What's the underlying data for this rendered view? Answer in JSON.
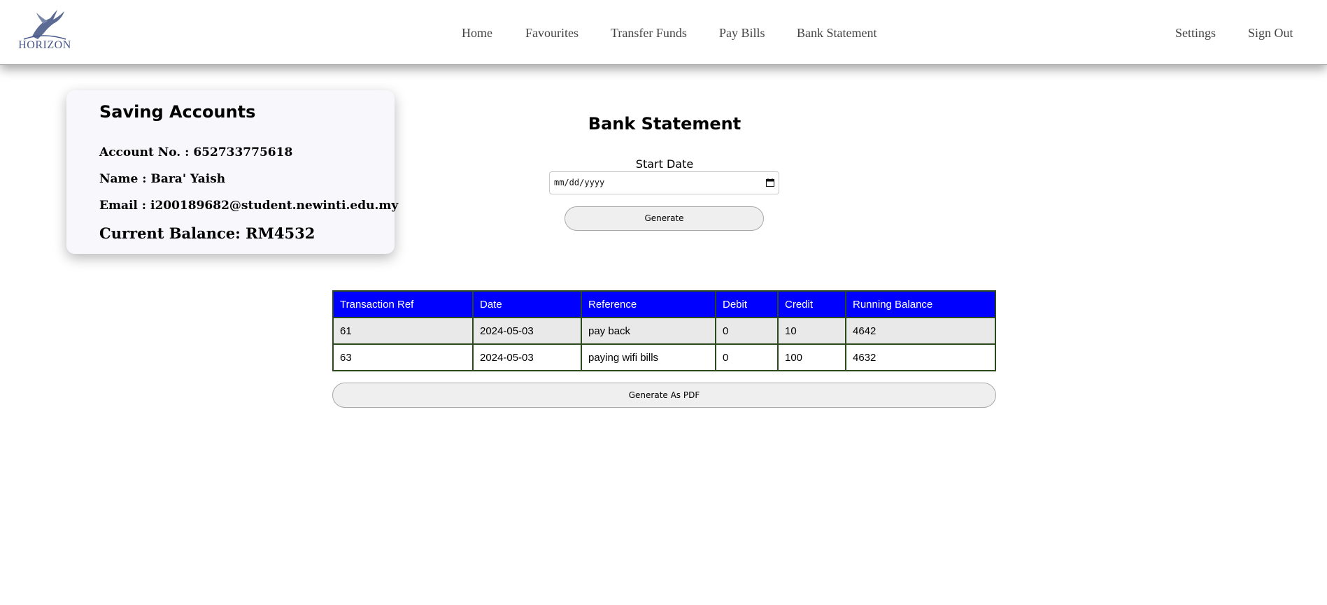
{
  "header": {
    "logo_text": "HORIZON",
    "nav": {
      "home": "Home",
      "favourites": "Favourites",
      "transfer_funds": "Transfer Funds",
      "pay_bills": "Pay Bills",
      "bank_statement": "Bank Statement",
      "settings": "Settings",
      "sign_out": "Sign Out"
    }
  },
  "account_card": {
    "title": "Saving Accounts",
    "account_no": "Account No. : 652733775618",
    "name": "Name : Bara' Yaish",
    "email": "Email : i200189682@student.newinti.edu.my",
    "balance": "Current Balance: RM4532"
  },
  "statement": {
    "title": "Bank Statement",
    "start_date_label": "Start Date",
    "start_date_placeholder": "mm/dd/yyyy",
    "generate_label": "Generate",
    "pdf_label": "Generate As PDF",
    "columns": [
      "Transaction Ref",
      "Date",
      "Reference",
      "Debit",
      "Credit",
      "Running Balance"
    ],
    "rows": [
      [
        "61",
        "2024-05-03",
        "pay back",
        "0",
        "10",
        "4642"
      ],
      [
        "63",
        "2024-05-03",
        "paying wifi bills",
        "0",
        "100",
        "4632"
      ]
    ]
  },
  "colors": {
    "table_header": "#0000ff",
    "table_border": "#2d4a1c",
    "logo": "#4a5a8c"
  }
}
